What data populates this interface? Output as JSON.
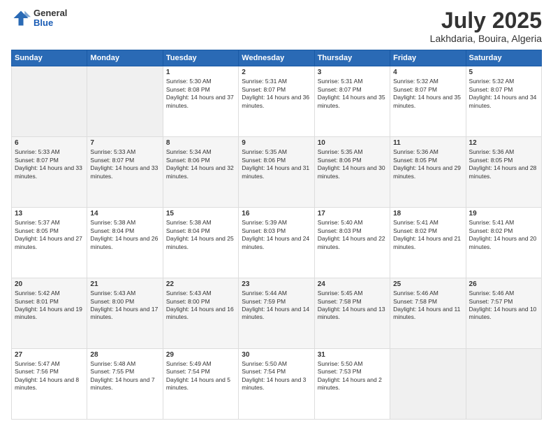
{
  "header": {
    "logo": {
      "general": "General",
      "blue": "Blue"
    },
    "title": "July 2025",
    "location": "Lakhdaria, Bouira, Algeria"
  },
  "calendar": {
    "days_of_week": [
      "Sunday",
      "Monday",
      "Tuesday",
      "Wednesday",
      "Thursday",
      "Friday",
      "Saturday"
    ],
    "weeks": [
      [
        {
          "day": "",
          "content": ""
        },
        {
          "day": "",
          "content": ""
        },
        {
          "day": "1",
          "content": "Sunrise: 5:30 AM\nSunset: 8:08 PM\nDaylight: 14 hours and 37 minutes."
        },
        {
          "day": "2",
          "content": "Sunrise: 5:31 AM\nSunset: 8:07 PM\nDaylight: 14 hours and 36 minutes."
        },
        {
          "day": "3",
          "content": "Sunrise: 5:31 AM\nSunset: 8:07 PM\nDaylight: 14 hours and 35 minutes."
        },
        {
          "day": "4",
          "content": "Sunrise: 5:32 AM\nSunset: 8:07 PM\nDaylight: 14 hours and 35 minutes."
        },
        {
          "day": "5",
          "content": "Sunrise: 5:32 AM\nSunset: 8:07 PM\nDaylight: 14 hours and 34 minutes."
        }
      ],
      [
        {
          "day": "6",
          "content": "Sunrise: 5:33 AM\nSunset: 8:07 PM\nDaylight: 14 hours and 33 minutes."
        },
        {
          "day": "7",
          "content": "Sunrise: 5:33 AM\nSunset: 8:07 PM\nDaylight: 14 hours and 33 minutes."
        },
        {
          "day": "8",
          "content": "Sunrise: 5:34 AM\nSunset: 8:06 PM\nDaylight: 14 hours and 32 minutes."
        },
        {
          "day": "9",
          "content": "Sunrise: 5:35 AM\nSunset: 8:06 PM\nDaylight: 14 hours and 31 minutes."
        },
        {
          "day": "10",
          "content": "Sunrise: 5:35 AM\nSunset: 8:06 PM\nDaylight: 14 hours and 30 minutes."
        },
        {
          "day": "11",
          "content": "Sunrise: 5:36 AM\nSunset: 8:05 PM\nDaylight: 14 hours and 29 minutes."
        },
        {
          "day": "12",
          "content": "Sunrise: 5:36 AM\nSunset: 8:05 PM\nDaylight: 14 hours and 28 minutes."
        }
      ],
      [
        {
          "day": "13",
          "content": "Sunrise: 5:37 AM\nSunset: 8:05 PM\nDaylight: 14 hours and 27 minutes."
        },
        {
          "day": "14",
          "content": "Sunrise: 5:38 AM\nSunset: 8:04 PM\nDaylight: 14 hours and 26 minutes."
        },
        {
          "day": "15",
          "content": "Sunrise: 5:38 AM\nSunset: 8:04 PM\nDaylight: 14 hours and 25 minutes."
        },
        {
          "day": "16",
          "content": "Sunrise: 5:39 AM\nSunset: 8:03 PM\nDaylight: 14 hours and 24 minutes."
        },
        {
          "day": "17",
          "content": "Sunrise: 5:40 AM\nSunset: 8:03 PM\nDaylight: 14 hours and 22 minutes."
        },
        {
          "day": "18",
          "content": "Sunrise: 5:41 AM\nSunset: 8:02 PM\nDaylight: 14 hours and 21 minutes."
        },
        {
          "day": "19",
          "content": "Sunrise: 5:41 AM\nSunset: 8:02 PM\nDaylight: 14 hours and 20 minutes."
        }
      ],
      [
        {
          "day": "20",
          "content": "Sunrise: 5:42 AM\nSunset: 8:01 PM\nDaylight: 14 hours and 19 minutes."
        },
        {
          "day": "21",
          "content": "Sunrise: 5:43 AM\nSunset: 8:00 PM\nDaylight: 14 hours and 17 minutes."
        },
        {
          "day": "22",
          "content": "Sunrise: 5:43 AM\nSunset: 8:00 PM\nDaylight: 14 hours and 16 minutes."
        },
        {
          "day": "23",
          "content": "Sunrise: 5:44 AM\nSunset: 7:59 PM\nDaylight: 14 hours and 14 minutes."
        },
        {
          "day": "24",
          "content": "Sunrise: 5:45 AM\nSunset: 7:58 PM\nDaylight: 14 hours and 13 minutes."
        },
        {
          "day": "25",
          "content": "Sunrise: 5:46 AM\nSunset: 7:58 PM\nDaylight: 14 hours and 11 minutes."
        },
        {
          "day": "26",
          "content": "Sunrise: 5:46 AM\nSunset: 7:57 PM\nDaylight: 14 hours and 10 minutes."
        }
      ],
      [
        {
          "day": "27",
          "content": "Sunrise: 5:47 AM\nSunset: 7:56 PM\nDaylight: 14 hours and 8 minutes."
        },
        {
          "day": "28",
          "content": "Sunrise: 5:48 AM\nSunset: 7:55 PM\nDaylight: 14 hours and 7 minutes."
        },
        {
          "day": "29",
          "content": "Sunrise: 5:49 AM\nSunset: 7:54 PM\nDaylight: 14 hours and 5 minutes."
        },
        {
          "day": "30",
          "content": "Sunrise: 5:50 AM\nSunset: 7:54 PM\nDaylight: 14 hours and 3 minutes."
        },
        {
          "day": "31",
          "content": "Sunrise: 5:50 AM\nSunset: 7:53 PM\nDaylight: 14 hours and 2 minutes."
        },
        {
          "day": "",
          "content": ""
        },
        {
          "day": "",
          "content": ""
        }
      ]
    ]
  }
}
